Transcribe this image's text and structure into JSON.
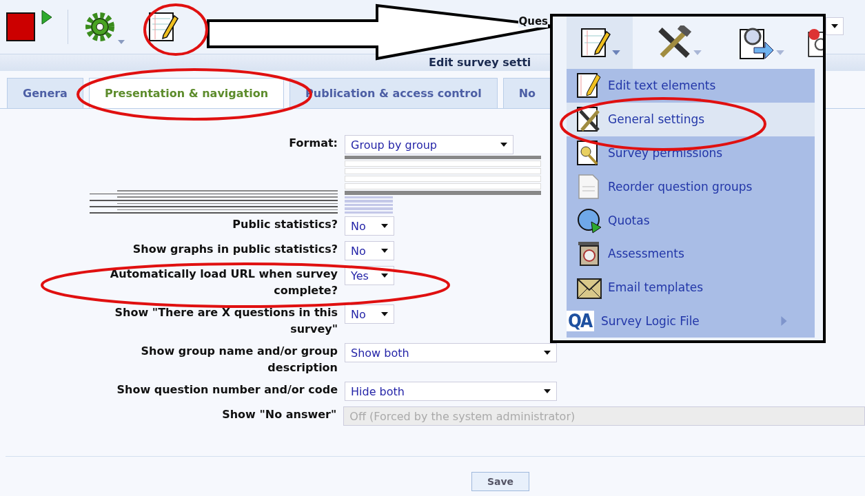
{
  "toolbar": {
    "cut_label": "Ques"
  },
  "page_title": "Edit survey setti",
  "tabs": [
    {
      "label": "Genera",
      "selected": false
    },
    {
      "label": "Presentation & navigation",
      "selected": true
    },
    {
      "label": "Publication & access control",
      "selected": false
    },
    {
      "label": "No",
      "selected": false
    }
  ],
  "settings": [
    {
      "label": "Format:",
      "value": "Group by group",
      "kind": "select"
    },
    {
      "label": "Public statistics?",
      "value": "No",
      "kind": "short"
    },
    {
      "label": "Show graphs in public statistics?",
      "value": "No",
      "kind": "short"
    },
    {
      "label": "Automatically load URL when survey complete?",
      "value": "Yes",
      "kind": "short"
    },
    {
      "label": "Show \"There are X questions in this survey\"",
      "value": "No",
      "kind": "short"
    },
    {
      "label": "Show group name and/or group description",
      "value": "Show both",
      "kind": "long"
    },
    {
      "label": "Show question number and/or code",
      "value": "Hide both",
      "kind": "long"
    },
    {
      "label": "Show \"No answer\"",
      "value": "Off (Forced by the system administrator)",
      "kind": "disabled"
    }
  ],
  "save_button": "Save",
  "menu": {
    "items": [
      {
        "label": "Edit text elements",
        "selected": false,
        "has_submenu": false
      },
      {
        "label": "General settings",
        "selected": true,
        "has_submenu": false
      },
      {
        "label": "Survey permissions",
        "selected": false,
        "has_submenu": false
      },
      {
        "label": "Reorder question groups",
        "selected": false,
        "has_submenu": false
      },
      {
        "label": "Quotas",
        "selected": false,
        "has_submenu": false
      },
      {
        "label": "Assessments",
        "selected": false,
        "has_submenu": false
      },
      {
        "label": "Email templates",
        "selected": false,
        "has_submenu": false
      },
      {
        "label": "Survey Logic File",
        "selected": false,
        "has_submenu": true,
        "logo_text": "QA"
      }
    ]
  }
}
